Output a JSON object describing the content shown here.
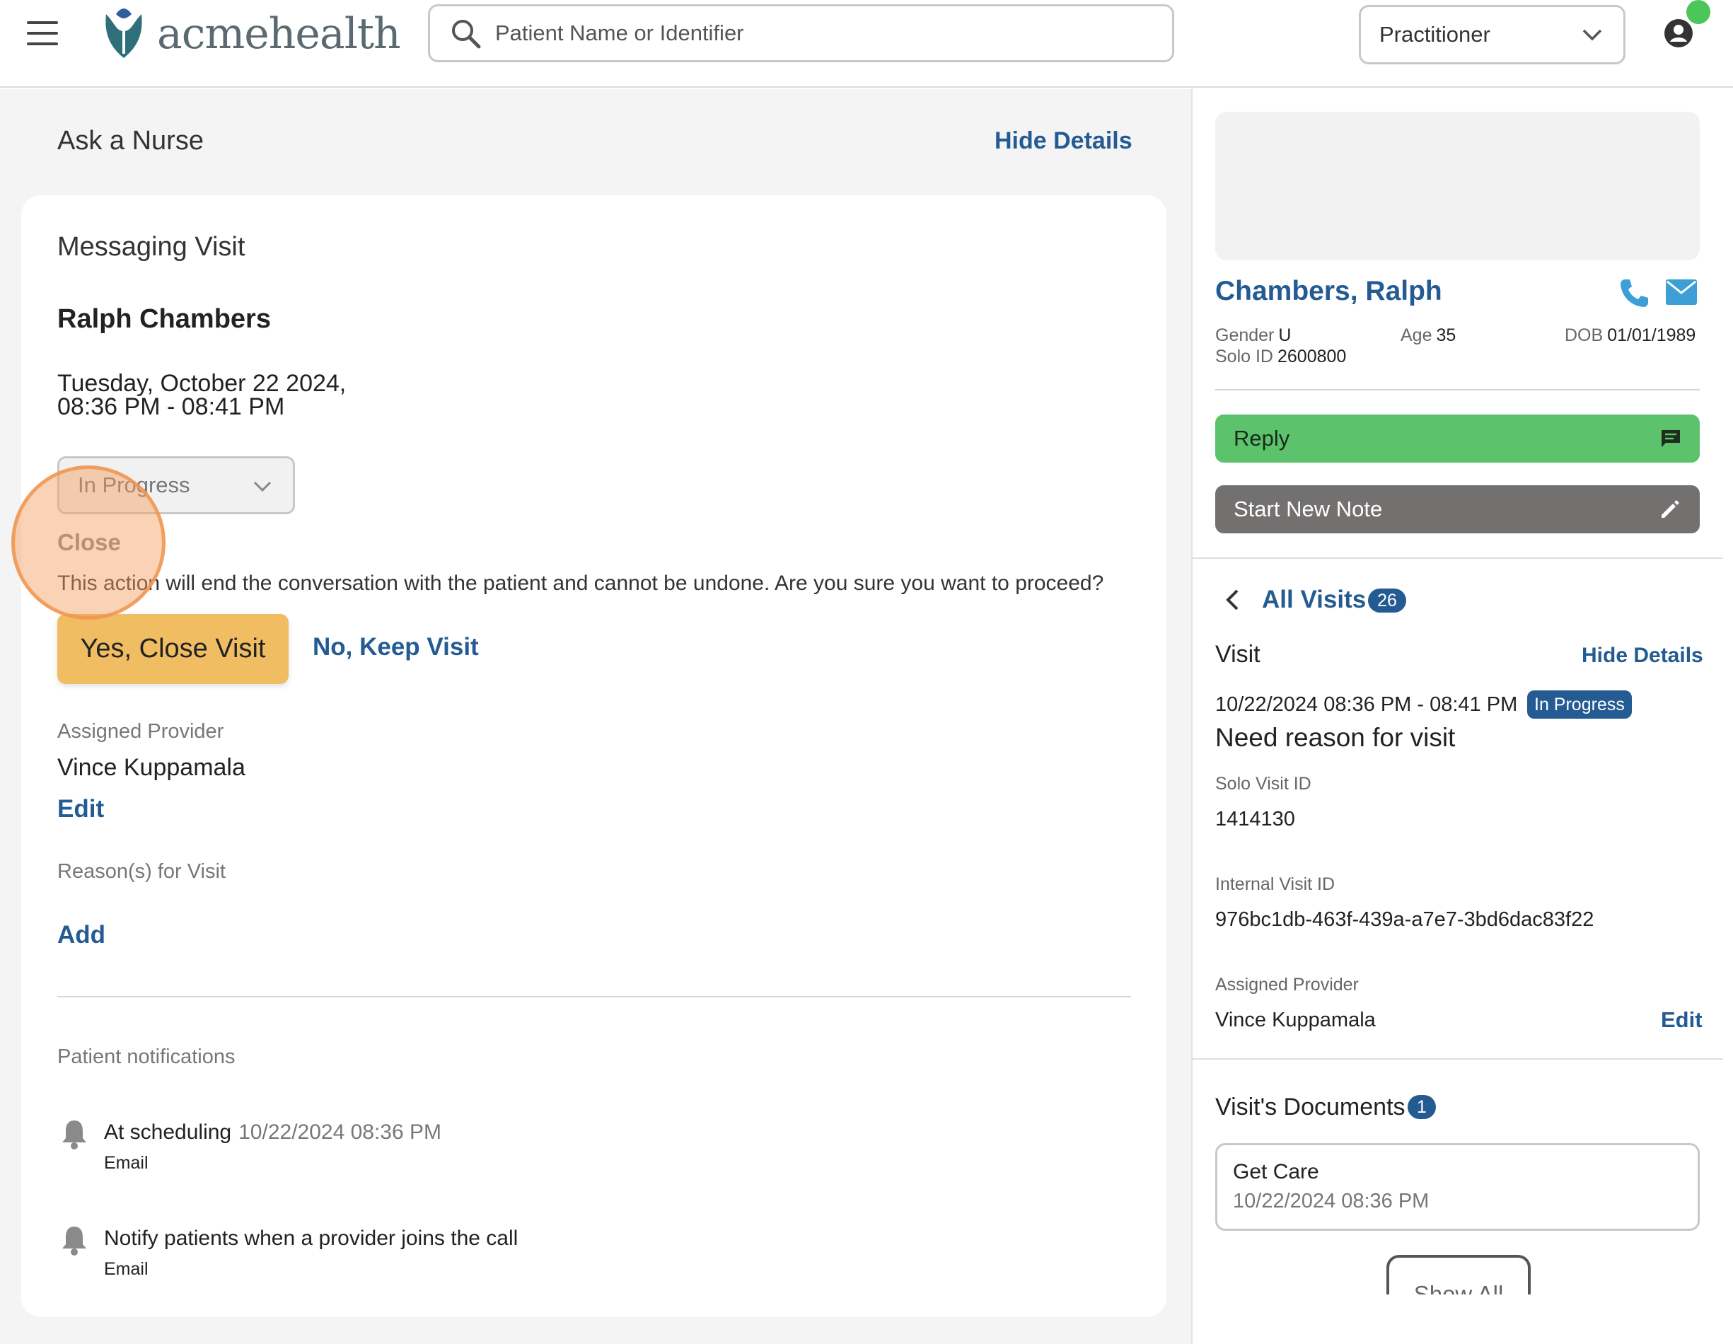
{
  "header": {
    "brand_name": "acmehealth",
    "search_placeholder": "Patient Name or Identifier",
    "role": "Practitioner"
  },
  "main": {
    "page_title": "Ask a Nurse",
    "hide_details": "Hide Details",
    "visit_type": "Messaging Visit",
    "patient_name": "Ralph Chambers",
    "date_line": "Tuesday, October 22 2024,",
    "time_line": "08:36 PM - 08:41 PM",
    "status_value": "In Progress",
    "close_label": "Close",
    "close_message": "This action will end the conversation with the patient and cannot be undone. Are you sure you want to proceed?",
    "yes_button": "Yes, Close Visit",
    "no_button": "No, Keep Visit",
    "assigned_provider_label": "Assigned Provider",
    "assigned_provider": "Vince Kuppamala",
    "edit_label": "Edit",
    "reasons_label": "Reason(s) for Visit",
    "add_label": "Add",
    "notifications_label": "Patient notifications",
    "notifications": [
      {
        "title": "At scheduling",
        "time": "10/22/2024 08:36 PM",
        "channel": "Email"
      },
      {
        "title": "Notify patients when a provider joins the call",
        "time": "",
        "channel": "Email"
      }
    ]
  },
  "patient": {
    "name": "Chambers, Ralph",
    "gender_label": "Gender",
    "gender": "U",
    "age_label": "Age",
    "age": "35",
    "dob_label": "DOB",
    "dob": "01/01/1989",
    "solo_id_label": "Solo ID",
    "solo_id": "2600800"
  },
  "actions": {
    "reply": "Reply",
    "start_note": "Start New Note"
  },
  "visit_panel": {
    "all_visits": "All Visits",
    "visit_count": "26",
    "visit_heading": "Visit",
    "hide_details": "Hide Details",
    "time_range": "10/22/2024 08:36 PM - 08:41 PM",
    "status": "In Progress",
    "reason": "Need reason for visit",
    "solo_visit_id_label": "Solo Visit ID",
    "solo_visit_id": "1414130",
    "internal_visit_id_label": "Internal Visit ID",
    "internal_visit_id": "976bc1db-463f-439a-a7e7-3bd6dac83f22",
    "assigned_provider_label": "Assigned Provider",
    "assigned_provider": "Vince Kuppamala",
    "edit_label": "Edit"
  },
  "documents": {
    "heading": "Visit's Documents",
    "count": "1",
    "items": [
      {
        "title": "Get Care",
        "time": "10/22/2024 08:36 PM"
      }
    ],
    "show_all": "Show All"
  },
  "colors": {
    "link_blue": "#245b93",
    "reply_green": "#5cc26b",
    "note_grey": "#737070",
    "confirm_amber": "#f0bd62",
    "online_green": "#4cc65a"
  },
  "icons": [
    "menu-icon",
    "logo-icon",
    "search-icon",
    "chevron-down-icon",
    "account-icon",
    "phone-icon",
    "mail-icon",
    "chat-icon",
    "pencil-icon",
    "chevron-left-icon",
    "bell-icon"
  ]
}
